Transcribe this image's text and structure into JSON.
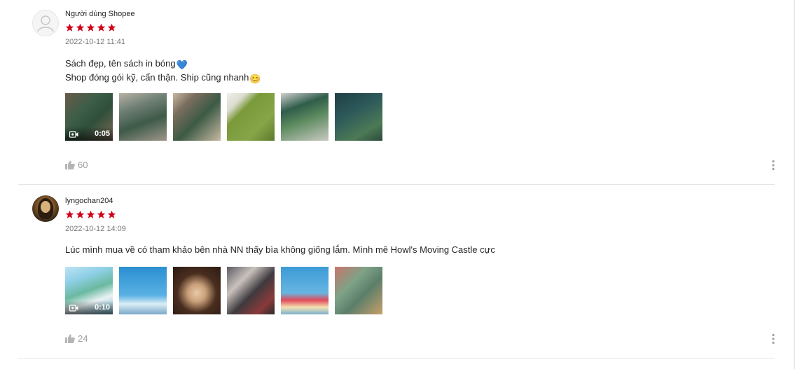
{
  "colors": {
    "star": "#d0011b",
    "muted": "#999999"
  },
  "reviews": [
    {
      "author": "Người dùng Shopee",
      "rating": 5,
      "time": "2022-10-12 11:41",
      "comment_line1": "Sách đẹp, tên sách in bóng",
      "comment_line1_emoji": "💙",
      "comment_line2": "Shop đóng gói kỹ, cẩn thận. Ship cũng nhanh",
      "comment_line2_emoji": "😊",
      "video_duration": "0:05",
      "likes": "60"
    },
    {
      "author": "lyngochan204",
      "rating": 5,
      "time": "2022-10-12 14:09",
      "comment_line1": "Lúc mình mua về có tham khảo bên nhà NN thấy bìa không giống lắm. Mình mê Howl's Moving Castle cực",
      "video_duration": "0:10",
      "likes": "24"
    }
  ]
}
